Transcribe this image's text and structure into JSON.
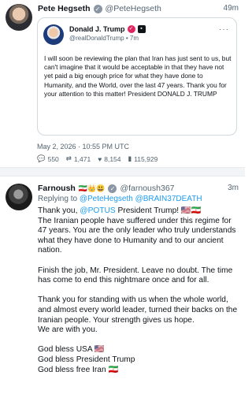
{
  "post1": {
    "author_name": "Pete Hegseth",
    "author_handle": "@PeteHegseth",
    "time": "49m",
    "quoted": {
      "author_name": "Donald J. Trump",
      "author_handle": "@realDonaldTrump",
      "time_sep": "•",
      "time": "7m",
      "more_label": "···",
      "text": "I will soon be reviewing the plan that Iran has just sent to us, but can't imagine that it would be acceptable in that they have not yet paid a big enough price for what they have done to Humanity, and the World, over the last 47 years. Thank you for your attention to this matter! President DONALD J. TRUMP"
    },
    "date": "May 2, 2026 · 10:55 PM UTC",
    "stats": {
      "replies": "550",
      "retweets": "1,471",
      "likes": "8,154",
      "views": "115,929"
    }
  },
  "post2": {
    "author_name": "Farnoush",
    "author_emoji": "🇮🇷👑😃",
    "author_handle": "@farnoush367",
    "time": "3m",
    "reply_prefix": "Replying to",
    "reply_to_1": "@PeteHegseth",
    "reply_to_2": "@BRAIN37DEATH",
    "line1_prefix": "Thank you,",
    "line1_mention": "@POTUS",
    "line1_suffix": "President Trump! 🇺🇸🇮🇷",
    "para1": "The Iranian people have suffered under this regime for 47 years. You are the only leader who truly understands what they have done to Humanity and to our ancient nation.",
    "para2": "Finish the job, Mr. President. Leave no doubt. The time has come to end this nightmare once and for all.",
    "para3a": "Thank you for standing with us when the whole world, and almost every world leader, turned their backs on the Iranian people. Your strength gives us hope.",
    "para3b": "We are with you.",
    "bless1": "God bless USA 🇺🇸",
    "bless2": "God bless President Trump",
    "bless3": "God bless free Iran 🇮🇷"
  },
  "icons": {
    "reply": "reply-icon",
    "retweet": "retweet-icon",
    "like": "heart-icon",
    "views": "views-icon",
    "verified": "verified-badge-icon"
  },
  "colors": {
    "accent": "#1d9bf0",
    "muted": "#536471",
    "text": "#0f1419"
  }
}
